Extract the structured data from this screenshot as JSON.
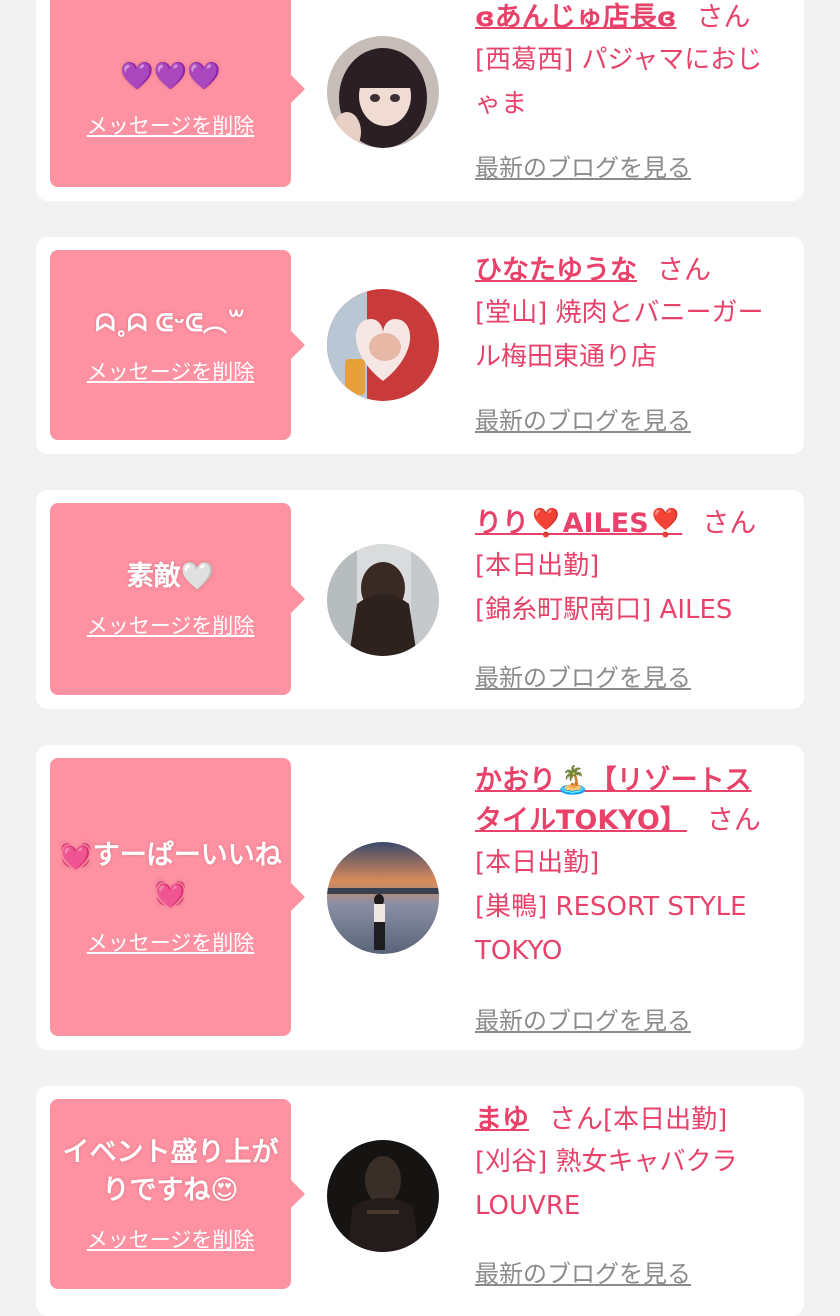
{
  "delete_label": "メッセージを削除",
  "blog_label": "最新のブログを見る",
  "honorific": "さん",
  "colors": {
    "bubble": "#fe92a2",
    "accent": "#e8426a",
    "link_gray": "#8b8b8b",
    "background": "#f2f2f2"
  },
  "cards": [
    {
      "message": "💜💜💜",
      "name": "ɞあんじゅ店長ɞ",
      "detail_lines": [
        "[西葛西] パジャマにおじ",
        "ゃま"
      ]
    },
    {
      "message": "ᗣ˳ᗣ ᕳᵕᕳ︵꒳",
      "name": "ひなたゆうな",
      "detail_lines": [
        "[堂山] 焼肉とバニーガー",
        "ル梅田東通り店"
      ]
    },
    {
      "message": "素敵🤍",
      "name": "りり❣️AILES❣️",
      "detail_lines": [
        "[本日出勤]",
        "[錦糸町駅南口] AILES"
      ]
    },
    {
      "message_lines": [
        "💓すーぱーいいね",
        "💓"
      ],
      "name_lines": [
        "かおり🏝️【リゾートス",
        "タイルTOKYO】"
      ],
      "detail_lines": [
        "[本日出勤]",
        "[巣鴨] RESORT STYLE",
        "TOKYO"
      ]
    },
    {
      "message_lines": [
        "イベント盛り上が",
        "りですね😍"
      ],
      "name": "まゆ",
      "inline_detail": "[本日出勤]",
      "detail_lines": [
        "[刈谷] 熟女キャバクラ",
        "LOUVRE"
      ]
    }
  ]
}
